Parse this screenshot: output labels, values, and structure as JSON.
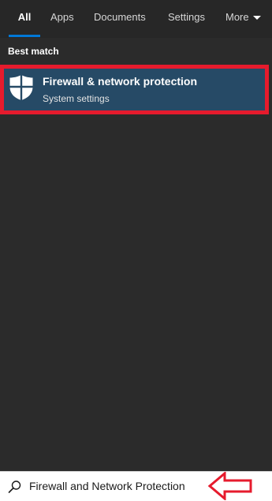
{
  "tabs": [
    {
      "label": "All",
      "active": true
    },
    {
      "label": "Apps",
      "active": false
    },
    {
      "label": "Documents",
      "active": false
    },
    {
      "label": "Settings",
      "active": false
    },
    {
      "label": "More",
      "active": false
    }
  ],
  "section_heading": "Best match",
  "best_match": {
    "title": "Firewall & network protection",
    "subtitle": "System settings",
    "icon": "shield-icon"
  },
  "search": {
    "value": "Firewall and Network Protection",
    "icon": "search-icon"
  },
  "colors": {
    "accent": "#0078d7",
    "highlight_border": "#e61b2d",
    "selected_result_bg": "#264a66",
    "panel_bg": "#2b2b2b"
  }
}
